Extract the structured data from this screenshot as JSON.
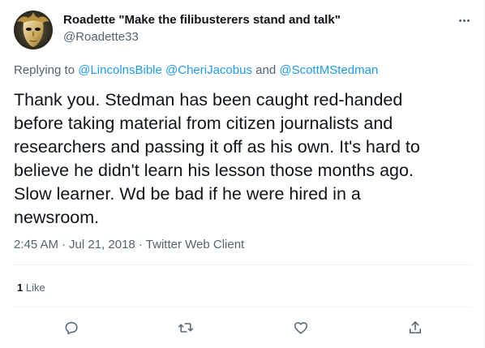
{
  "tweet": {
    "author_name": "Roadette \"Make the filibusterers stand and talk\"",
    "author_handle": "@Roadette33",
    "replying_prefix": "Replying to",
    "replying_to": [
      "@LincolnsBible",
      "@CheriJacobus"
    ],
    "replying_and": "and",
    "replying_last": "@ScottMStedman",
    "text_lines": [
      "Thank you. Stedman has been caught red-handed",
      "before taking material from citizen journalists and",
      "researchers and passing it off as his own. It's hard to",
      "believe he didn't learn his lesson those months ago.",
      "Slow learner. Wd be bad if he were hired in a",
      "newsroom."
    ],
    "time": "2:45 AM",
    "date": "Jul 21, 2018",
    "separator": "·",
    "client": "Twitter Web Client",
    "likes_count": "1",
    "likes_label": "Like"
  },
  "icons": {
    "more": "more-options-icon",
    "reply": "reply-icon",
    "retweet": "retweet-icon",
    "like": "heart-icon",
    "share": "share-icon"
  },
  "colors": {
    "link": "#1d9bf0",
    "secondary": "#536471",
    "primary": "#0f1419",
    "divider": "#eff3f4"
  }
}
